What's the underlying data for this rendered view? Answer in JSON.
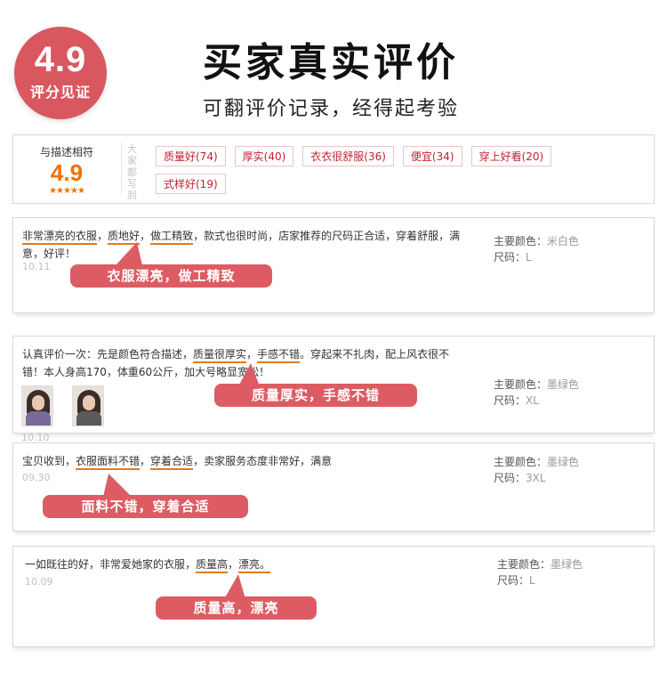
{
  "badge": {
    "score": "4.9",
    "label": "评分见证"
  },
  "header": {
    "title": "买家真实评价",
    "subtitle": "可翻评价记录，经得起考验"
  },
  "summary": {
    "caption": "与描述相符",
    "score": "4.9",
    "stars": "★★★★★",
    "side_label": "大家都写到",
    "tags": [
      "质量好(74)",
      "厚实(40)",
      "衣衣很舒服(36)",
      "便宜(34)",
      "穿上好看(20)",
      "式样好(19)"
    ]
  },
  "reviews": [
    {
      "segments": [
        "",
        "非常漂亮的衣服",
        "，",
        "质地好",
        "，",
        "做工精致",
        "，款式也很时尚，店家推荐的尺码正合适，穿着舒服，满意，好评！"
      ],
      "date": "10.11",
      "color_label": "主要颜色：",
      "color_value": "米白色",
      "size_label": "尺码：",
      "size_value": "L",
      "callout": "衣服漂亮，做工精致"
    },
    {
      "segments": [
        "认真评价一次：先是颜色符合描述，",
        "质量很厚实",
        "，",
        "手感不错",
        "。穿起来不扎肉，配上风衣很不错！本人身高170，体重60公斤，加大号略显宽松！",
        "",
        ""
      ],
      "date": "10.10",
      "photos": [
        "buyer-photo-1",
        "buyer-photo-2"
      ],
      "color_label": "主要颜色：",
      "color_value": "墨绿色",
      "size_label": "尺码：",
      "size_value": "XL",
      "callout": "质量厚实，手感不错"
    },
    {
      "segments": [
        "宝贝收到，",
        "衣服面料不错",
        "，",
        "穿着合适",
        "，卖家服务态度非常好，满意",
        "",
        ""
      ],
      "date": "09.30",
      "color_label": "主要颜色：",
      "color_value": "墨绿色",
      "size_label": "尺码：",
      "size_value": "3XL",
      "callout": "面料不错，穿着合适"
    },
    {
      "segments": [
        "一如既往的好，非常爱她家的衣服，",
        "质量高",
        "，",
        "漂亮。",
        "",
        "",
        ""
      ],
      "date": "10.09",
      "color_label": "主要颜色：",
      "color_value": "墨绿色",
      "size_label": "尺码：",
      "size_value": "L",
      "callout": "质量高，漂亮"
    }
  ],
  "colors": {
    "accent": "#dd5c63",
    "badge": "#d9575f",
    "score": "#f07200",
    "tag_text": "#c32033",
    "underline": "#e07a22"
  }
}
